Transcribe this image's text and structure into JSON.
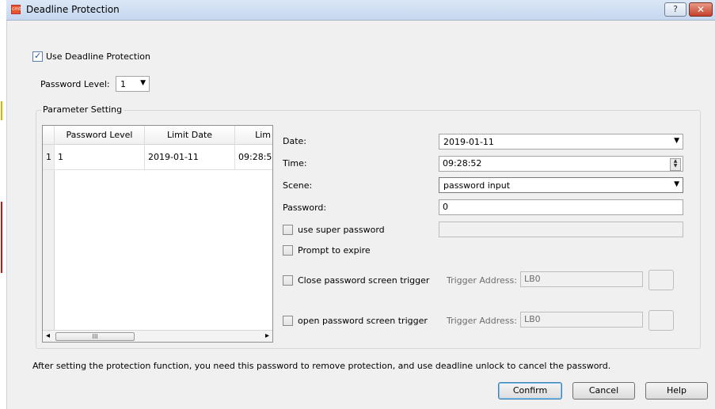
{
  "window": {
    "title": "Deadline Protection",
    "icon_text": "cmt",
    "help_glyph": "?",
    "close_glyph": "✕"
  },
  "use_protection": {
    "label": "Use Deadline Protection",
    "checked": true
  },
  "password_level": {
    "label": "Password Level:",
    "value": "1"
  },
  "parameter_setting": {
    "title": "Parameter Setting",
    "table": {
      "columns": [
        "Password Level",
        "Limit Date",
        "Lim"
      ],
      "rows": [
        {
          "index": "1",
          "password_level": "1",
          "limit_date": "2019-01-11",
          "limit_time": "09:28:5"
        }
      ],
      "scroll_thumb": "III",
      "scroll_left": "◂",
      "scroll_right": "▸"
    },
    "date": {
      "label": "Date:",
      "value": "2019-01-11"
    },
    "time": {
      "label": "Time:",
      "value": "09:28:52"
    },
    "scene": {
      "label": "Scene:",
      "value": "password input"
    },
    "password": {
      "label": "Password:",
      "value": "0"
    },
    "use_super_password": {
      "label": "use super password",
      "checked": false,
      "value": ""
    },
    "prompt_to_expire": {
      "label": "Prompt to expire",
      "checked": false
    },
    "close_trigger": {
      "label": "Close password screen trigger",
      "checked": false,
      "address_label": "Trigger Address:",
      "address_value": "LB0"
    },
    "open_trigger": {
      "label": "open password screen trigger",
      "checked": false,
      "address_label": "Trigger Address:",
      "address_value": "LB0"
    }
  },
  "footer_note": "After setting the protection function, you need this password to remove protection, and use deadline unlock to cancel the password.",
  "buttons": {
    "confirm": "Confirm",
    "cancel": "Cancel",
    "help": "Help"
  },
  "icons": {
    "dropdown": "chevron-down-icon",
    "check": "checkmark-icon",
    "spin": "spin-arrows-icon"
  }
}
